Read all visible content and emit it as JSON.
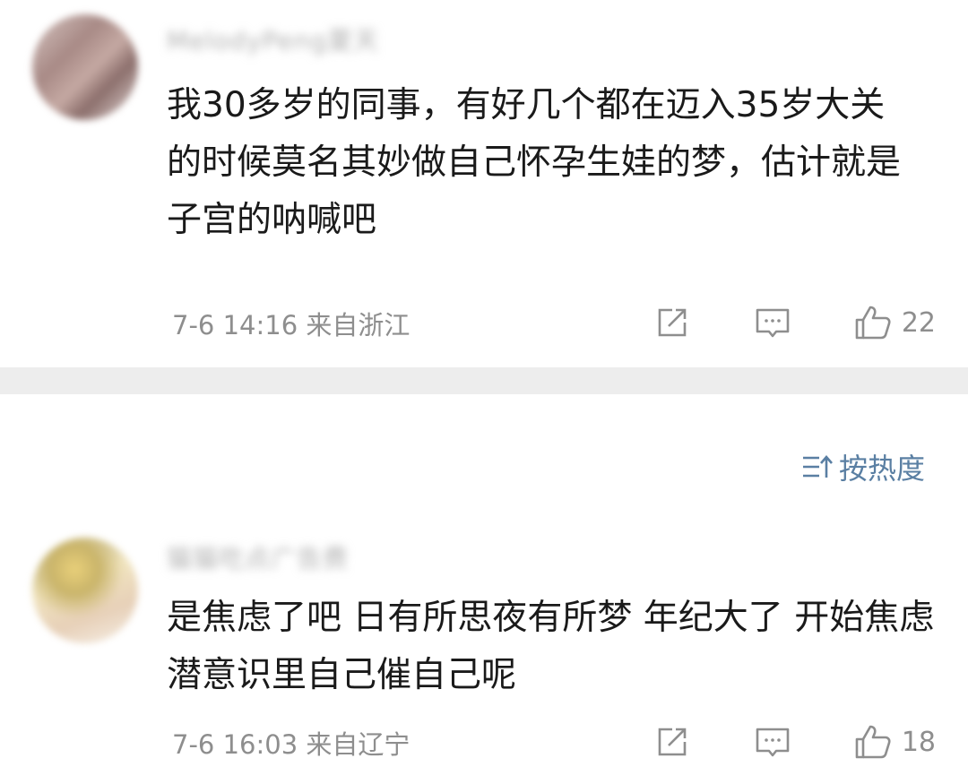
{
  "comments": [
    {
      "username": "MelodyPeng夏天",
      "content": "我30多岁的同事，有好几个都在迈入35岁大关的时候莫名其妙做自己怀孕生娃的梦，估计就是子宫的呐喊吧",
      "time": "7-6 14:16",
      "location": "来自浙江",
      "likes": "22"
    },
    {
      "username": "猫猫吃点广告费",
      "content": "是焦虑了吧 日有所思夜有所梦 年纪大了 开始焦虑 潜意识里自己催自己呢",
      "time": "7-6 16:03",
      "location": "来自辽宁",
      "likes": "18"
    }
  ],
  "sort": {
    "label": "按热度"
  },
  "icons": {
    "share": "share-icon",
    "reply": "comment-icon",
    "like": "thumbs-up-icon",
    "sort": "sort-icon"
  },
  "colors": {
    "text": "#1a1a1a",
    "meta": "#8e8e8e",
    "accent": "#5a7fa3",
    "separator": "#ededed"
  }
}
